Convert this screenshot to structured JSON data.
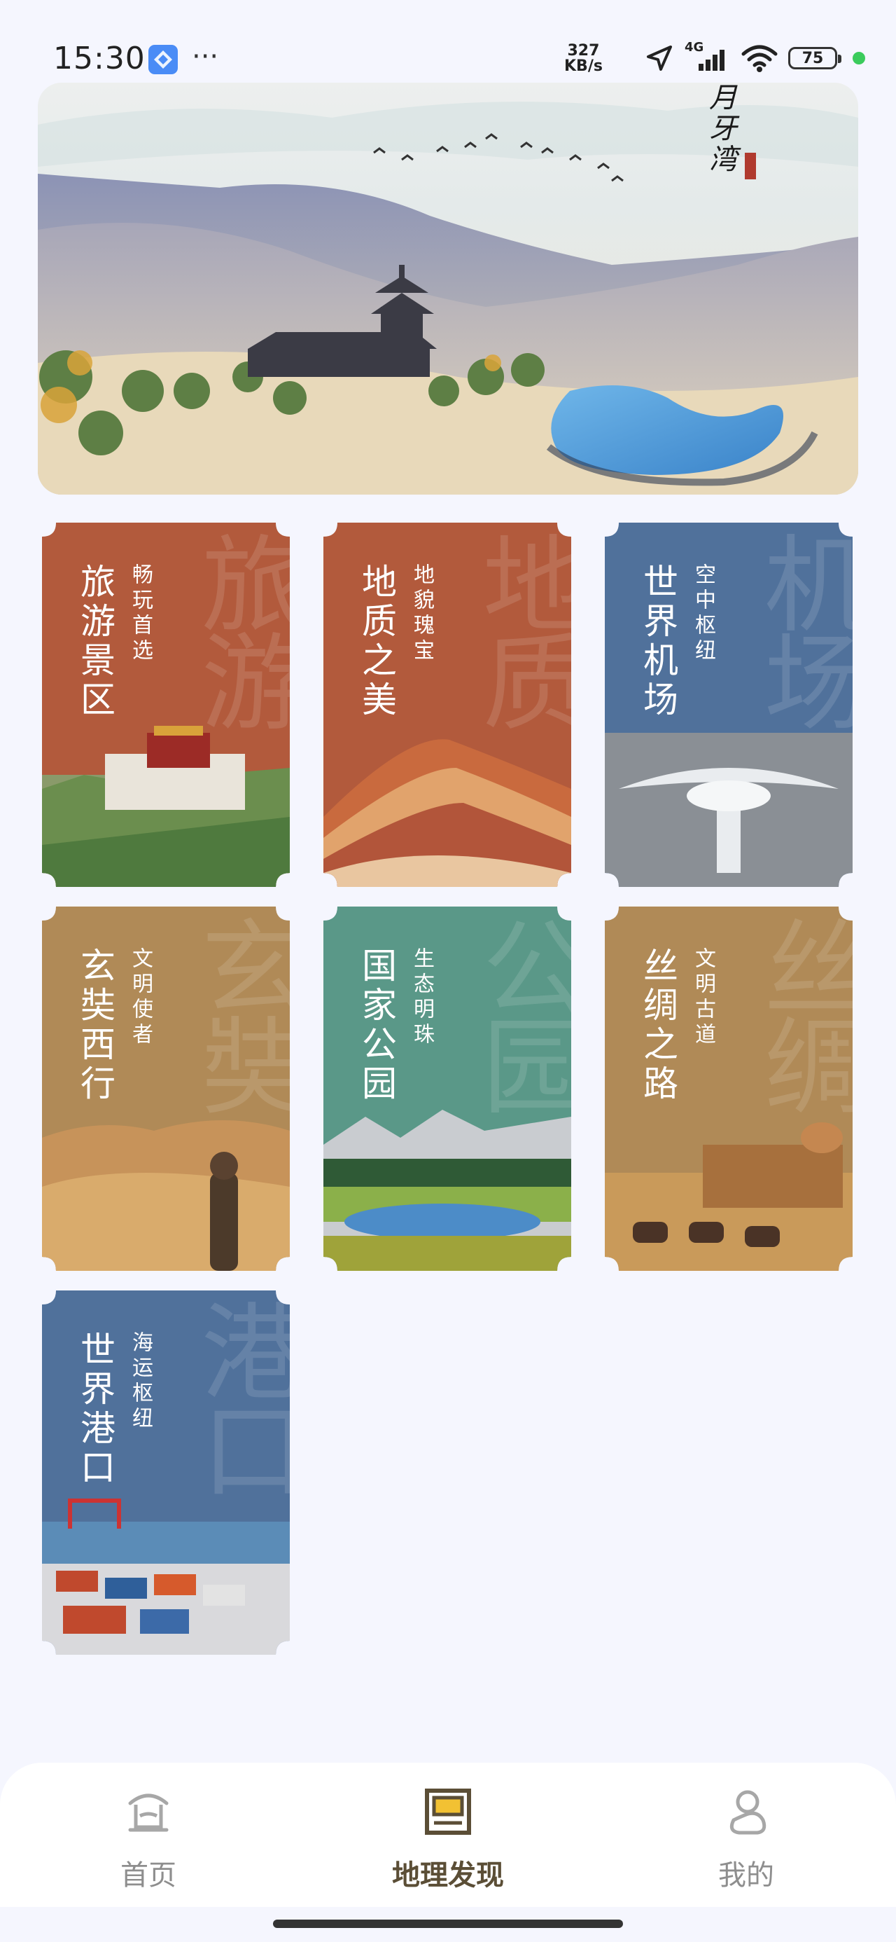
{
  "status_bar": {
    "time": "15:30",
    "net_speed_value": "327",
    "net_speed_unit": "KB/s",
    "network": "4G",
    "battery": "75",
    "icons": [
      "app-icon",
      "more-dots-icon",
      "location-arrow-icon",
      "signal-icon",
      "wifi-icon",
      "battery-icon"
    ]
  },
  "banner": {
    "title": "月牙湾",
    "seal": "月牙湾"
  },
  "cards": [
    {
      "title": "旅游景区",
      "subtitle": "畅玩首选",
      "watermark": "旅游",
      "color": "#B25A3C",
      "image": "potala-palace"
    },
    {
      "title": "地质之美",
      "subtitle": "地貌瑰宝",
      "watermark": "地质",
      "color": "#B25A3C",
      "image": "rainbow-mountains"
    },
    {
      "title": "世界机场",
      "subtitle": "空中枢纽",
      "watermark": "机场",
      "color": "#50719B",
      "image": "airport-terminal"
    },
    {
      "title": "玄奘西行",
      "subtitle": "文明使者",
      "watermark": "玄奘",
      "color": "#B08A57",
      "image": "desert-pilgrim"
    },
    {
      "title": "国家公园",
      "subtitle": "生态明珠",
      "watermark": "公园",
      "color": "#5A9888",
      "image": "mountain-lake"
    },
    {
      "title": "丝绸之路",
      "subtitle": "文明古道",
      "watermark": "丝绸",
      "color": "#B08A57",
      "image": "camel-caravan"
    },
    {
      "title": "世界港口",
      "subtitle": "海运枢纽",
      "watermark": "港口",
      "color": "#50719B",
      "image": "container-port"
    }
  ],
  "tabbar": {
    "tabs": [
      {
        "label": "首页",
        "icon": "pavilion-home-icon",
        "active": false
      },
      {
        "label": "地理发现",
        "icon": "frame-discover-icon",
        "active": true
      },
      {
        "label": "我的",
        "icon": "profile-icon",
        "active": false
      }
    ]
  }
}
